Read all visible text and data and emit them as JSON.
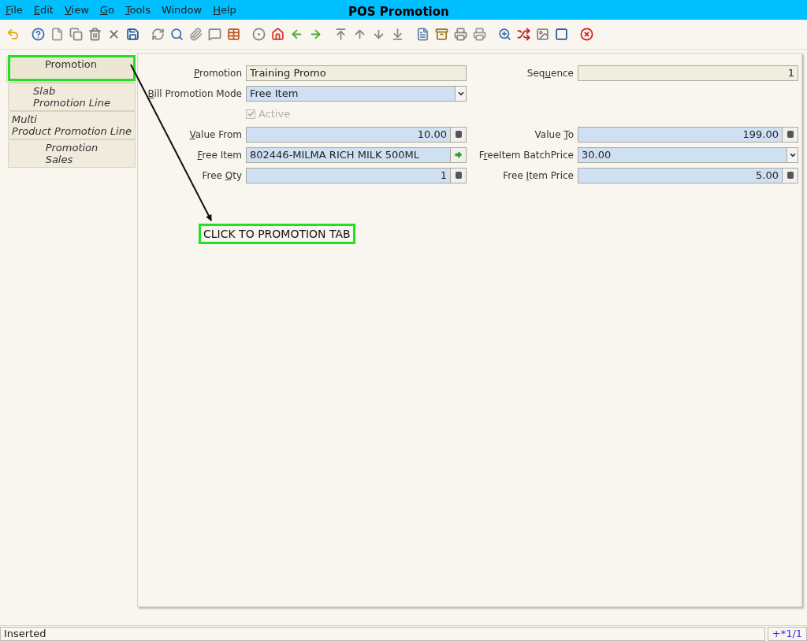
{
  "window": {
    "title": "POS Promotion"
  },
  "menu": [
    {
      "key": "F",
      "post": "ile"
    },
    {
      "key": "E",
      "post": "dit"
    },
    {
      "key": "V",
      "post": "iew"
    },
    {
      "key": "G",
      "post": "o"
    },
    {
      "key": "T",
      "post": "ools"
    },
    {
      "pre": "Window"
    },
    {
      "key": "H",
      "post": "elp"
    }
  ],
  "tabs": [
    {
      "lines": [
        "Promotion"
      ],
      "selected": true,
      "children": [
        {
          "lines": [
            "Slab",
            "Promotion Line"
          ],
          "selected": false
        },
        {
          "lines": [
            "Multi",
            "Product Promotion Line"
          ],
          "selected": false
        },
        {
          "lines": [
            "Promotion",
            "Sales"
          ],
          "selected": false
        }
      ]
    }
  ],
  "form": {
    "rows": [
      {
        "left": {
          "label": {
            "key": "P",
            "post": "romotion"
          },
          "kind": "readonly",
          "value": "Training Promo"
        },
        "right": {
          "label": {
            "pre": "Seq",
            "key": "u",
            "post": "ence"
          },
          "kind": "readonly_number",
          "value": "1"
        }
      },
      {
        "left": {
          "label": {
            "key": "B",
            "post": "ill Promotion Mode"
          },
          "kind": "combo",
          "value": "Free Item"
        }
      },
      {
        "left": {
          "kind": "checkbox",
          "text": "Active",
          "checked": true,
          "disabled": true
        }
      },
      {
        "left": {
          "label": {
            "key": "V",
            "post": "alue From"
          },
          "kind": "number",
          "value": "10.00"
        },
        "right": {
          "label": {
            "pre": "Value ",
            "key": "T",
            "post": "o"
          },
          "kind": "number",
          "value": "199.00"
        }
      },
      {
        "left": {
          "label": {
            "key": "F",
            "post": "ree Item"
          },
          "kind": "search",
          "value": "802446-MILMA RICH MILK 500ML"
        },
        "right": {
          "label": {
            "pre": "F",
            "key": "r",
            "post": "eeItem BatchPrice"
          },
          "kind": "combo",
          "value": "30.00"
        }
      },
      {
        "left": {
          "label": {
            "pre": "Free ",
            "key": "Q",
            "post": "ty"
          },
          "kind": "number",
          "value": "1"
        },
        "right": {
          "label": {
            "pre": "Free ",
            "key": "I",
            "post": "tem Price"
          },
          "kind": "number",
          "value": "5.00"
        }
      }
    ]
  },
  "annotation": {
    "callout": "CLICK TO PROMOTION TAB"
  },
  "status_bar": {
    "message": "Inserted",
    "record": "+*1/1"
  }
}
